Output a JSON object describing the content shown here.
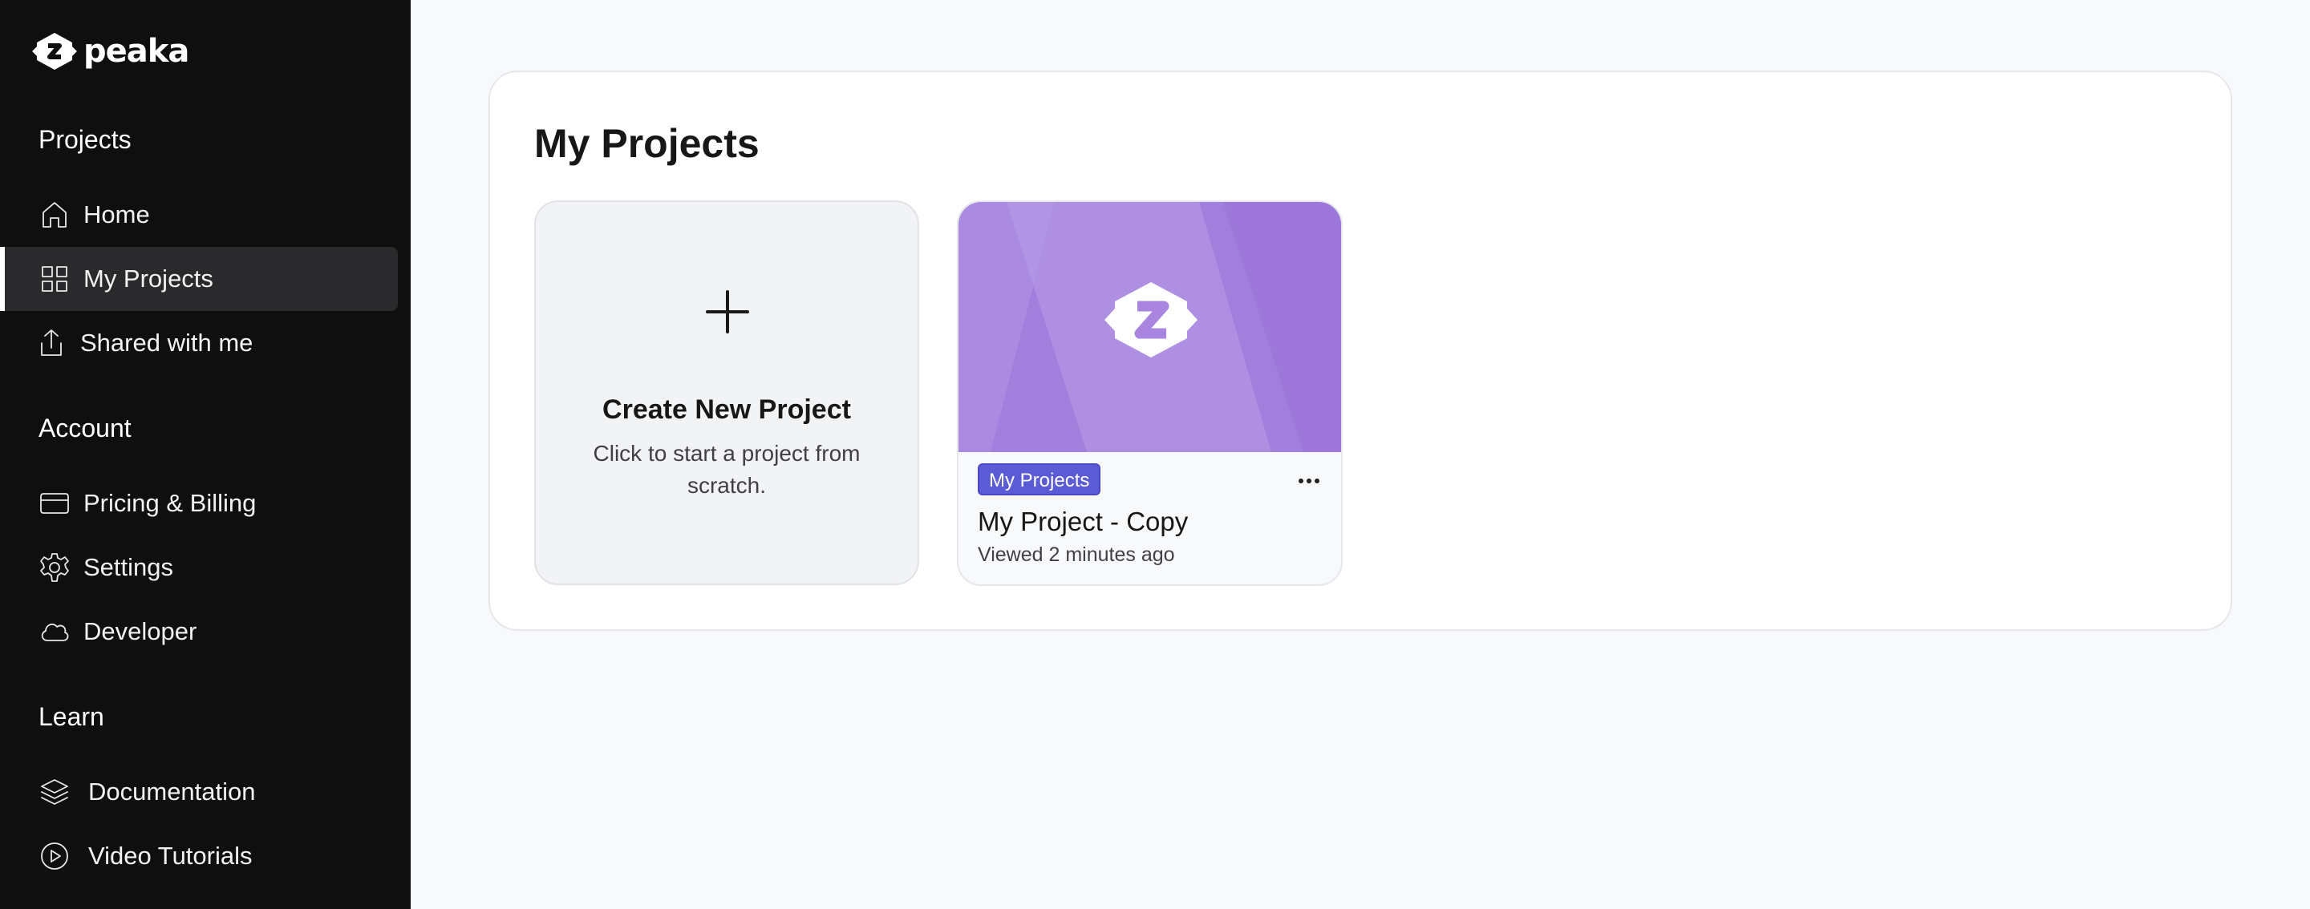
{
  "brand": {
    "name": "peaka"
  },
  "sidebar": {
    "sections": [
      {
        "title": "Projects",
        "items": [
          {
            "label": "Home",
            "icon": "home-icon",
            "active": false
          },
          {
            "label": "My Projects",
            "icon": "grid-icon",
            "active": true
          },
          {
            "label": "Shared with me",
            "icon": "share-icon",
            "active": false
          }
        ]
      },
      {
        "title": "Account",
        "items": [
          {
            "label": "Pricing & Billing",
            "icon": "credit-card-icon",
            "active": false
          },
          {
            "label": "Settings",
            "icon": "gear-icon",
            "active": false
          },
          {
            "label": "Developer",
            "icon": "cloud-icon",
            "active": false
          }
        ]
      },
      {
        "title": "Learn",
        "items": [
          {
            "label": "Documentation",
            "icon": "layers-icon",
            "active": false
          },
          {
            "label": "Video Tutorials",
            "icon": "play-circle-icon",
            "active": false
          }
        ]
      }
    ]
  },
  "main": {
    "title": "My Projects",
    "create_card": {
      "title": "Create New Project",
      "description": "Click to start a project from scratch.",
      "icon": "plus-icon"
    },
    "projects": [
      {
        "tag": "My Projects",
        "name": "My Project - Copy",
        "viewed": "Viewed 2 minutes ago",
        "thumbnail_icon": "peaka-logo-icon",
        "menu_icon": "more-icon"
      }
    ]
  },
  "colors": {
    "sidebar_bg": "#0f0f0f",
    "page_bg": "#f8f9fa",
    "tag_bg": "#5b5bd6",
    "thumb_purple": "#a27fdd"
  }
}
